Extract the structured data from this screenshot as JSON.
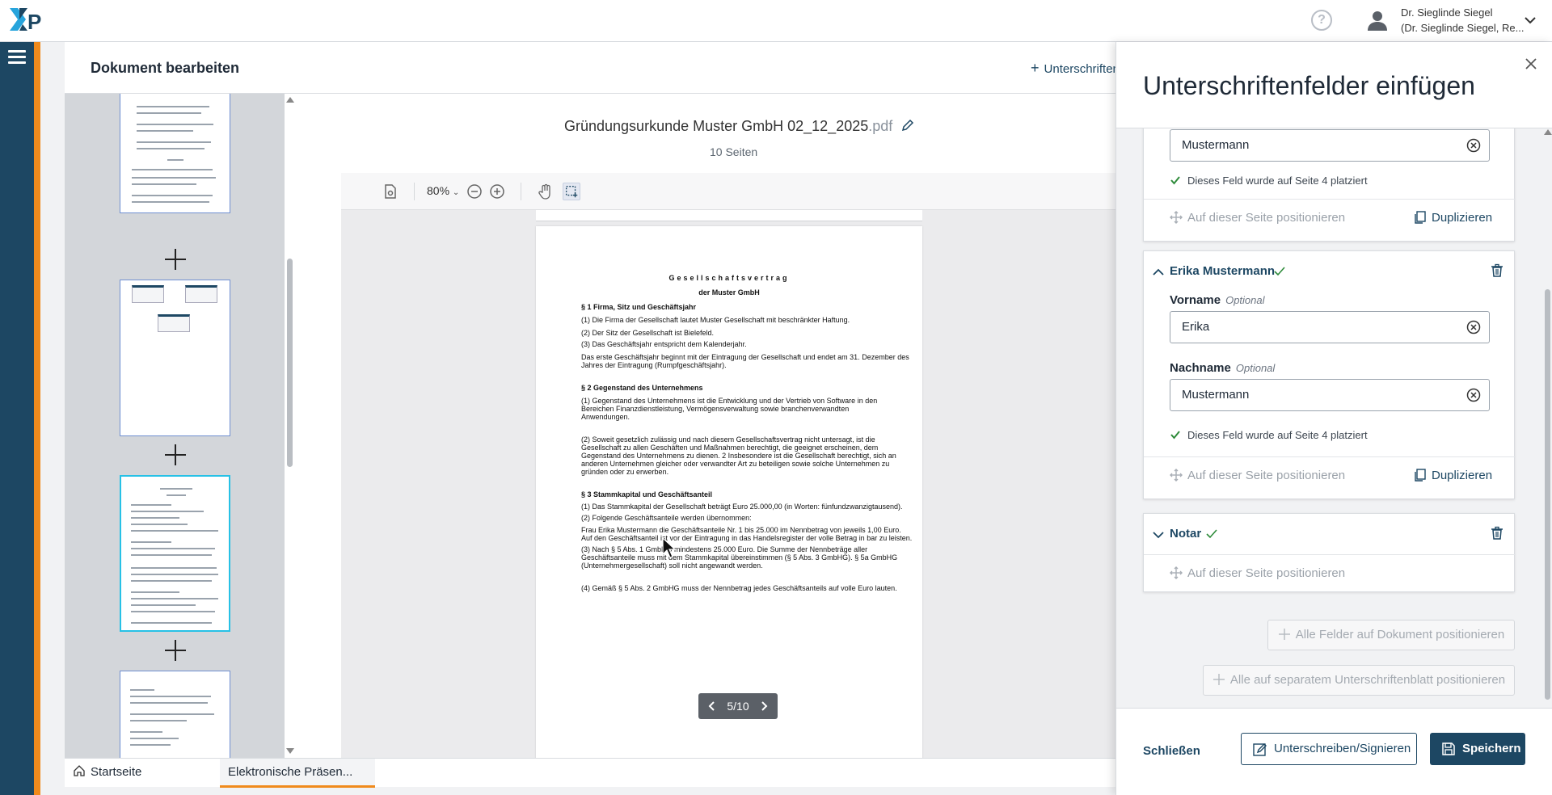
{
  "app": {
    "logo": "XP"
  },
  "user": {
    "name": "Dr. Sieglinde Siegel",
    "role": "(Dr. Sieglinde Siegel, Re..."
  },
  "header": {
    "title": "Dokument bearbeiten",
    "add_label": "Unterschriften"
  },
  "document": {
    "name": "Gründungsurkunde Muster GmbH 02_12_2025",
    "ext": ".pdf",
    "pages_label": "10 Seiten",
    "zoom": "80%",
    "pager": "5/10",
    "page": {
      "title": "Gesellschaftsvertrag",
      "subtitle": "der Muster GmbH",
      "lines": [
        {
          "text": "§ 1 Firma, Sitz und Geschäftsjahr",
          "bold": true
        },
        {
          "text": "(1) Die Firma der Gesellschaft lautet Muster Gesellschaft mit beschränkter Haftung."
        },
        {
          "text": "(2) Der Sitz der Gesellschaft ist Bielefeld."
        },
        {
          "text": "(3) Das Geschäftsjahr entspricht dem Kalenderjahr."
        },
        {
          "text": "Das erste Geschäftsjahr beginnt mit der Eintragung der Gesellschaft und endet am 31. Dezember des"
        },
        {
          "text": "Jahres der Eintragung (Rumpfgeschäftsjahr)."
        },
        {
          "text": "§ 2 Gegenstand des Unternehmens",
          "bold": true
        },
        {
          "text": "(1)  Gegenstand des Unternehmens ist die Entwicklung und der Vertrieb von Software in den"
        },
        {
          "text": "      Bereichen Finanzdienstleistung, Vermögensverwaltung sowie branchenverwandten"
        },
        {
          "text": "      Anwendungen."
        },
        {
          "text": "(2)  Soweit gesetzlich zulässig und nach diesem Gesellschaftsvertrag nicht untersagt, ist die"
        },
        {
          "text": "      Gesellschaft zu allen Geschäften und Maßnahmen berechtigt, die geeignet erscheinen, dem"
        },
        {
          "text": "      Gegenstand des Unternehmens zu dienen. 2 Insbesondere ist die Gesellschaft berechtigt, sich an"
        },
        {
          "text": "      anderen Unternehmen gleicher oder verwandter Art zu beteiligen sowie solche Unternehmen zu"
        },
        {
          "text": "      gründen oder zu erwerben."
        },
        {
          "text": "§ 3 Stammkapital und Geschäftsanteil",
          "bold": true
        },
        {
          "text": "(1)  Das Stammkapital der Gesellschaft beträgt Euro 25.000,00 (in Worten: fünfundzwanzigtausend)."
        },
        {
          "text": "(2)  Folgende Geschäftsanteile werden übernommen:"
        },
        {
          "text": "Frau Erika Mustermann die Geschäftsanteile Nr. 1 bis 25.000 im Nennbetrag von jeweils 1,00 Euro."
        },
        {
          "text": "Auf den Geschäftsanteil ist vor der Eintragung in das Handelsregister der volle Betrag in bar zu leisten."
        },
        {
          "text": "(3)  Nach § 5 Abs. 1 GmbHG mindestens 25.000 Euro. Die Summe der Nennbeträge aller"
        },
        {
          "text": "      Geschäftsanteile muss mit dem Stammkapital übereinstimmen (§ 5 Abs. 3 GmbHG). § 5a GmbHG"
        },
        {
          "text": "      (Unternehmergesellschaft) soll nicht angewandt werden."
        },
        {
          "text": "(4)  Gemäß § 5 Abs. 2 GmbHG muss der Nennbetrag jedes Geschäftsanteils auf volle Euro lauten."
        }
      ]
    }
  },
  "panel": {
    "title": "Unterschriftenfelder einfügen",
    "top_card": {
      "input_value": "Mustermann",
      "placed_text": "Dieses Feld wurde auf Seite 4 platziert",
      "position_label": "Auf dieser Seite positionieren",
      "duplicate_label": "Duplizieren"
    },
    "erika_card": {
      "name": "Erika Mustermann",
      "vorname_label": "Vorname",
      "optional_label": "Optional",
      "vorname_value": "Erika",
      "nachname_label": "Nachname",
      "nachname_value": "Mustermann",
      "placed_text": "Dieses Feld wurde auf Seite 4 platziert",
      "position_label": "Auf dieser Seite positionieren",
      "duplicate_label": "Duplizieren"
    },
    "notar_card": {
      "name": "Notar",
      "position_label": "Auf dieser Seite positionieren"
    },
    "btn_all_doc": "Alle Felder auf Dokument positionieren",
    "btn_all_sheet": "Alle auf separatem Unterschriftenblatt positionieren",
    "footer": {
      "close_label": "Schließen",
      "sign_label": "Unterschreiben/Signieren",
      "save_label": "Speichern"
    }
  },
  "tabs": [
    {
      "label": "Startseite"
    },
    {
      "label": "Elektronische Präsen..."
    }
  ],
  "colors": {
    "brand": "#1d4763",
    "accent": "#f08a1c",
    "highlight": "#27c1e6",
    "success": "#2e8b3a"
  }
}
